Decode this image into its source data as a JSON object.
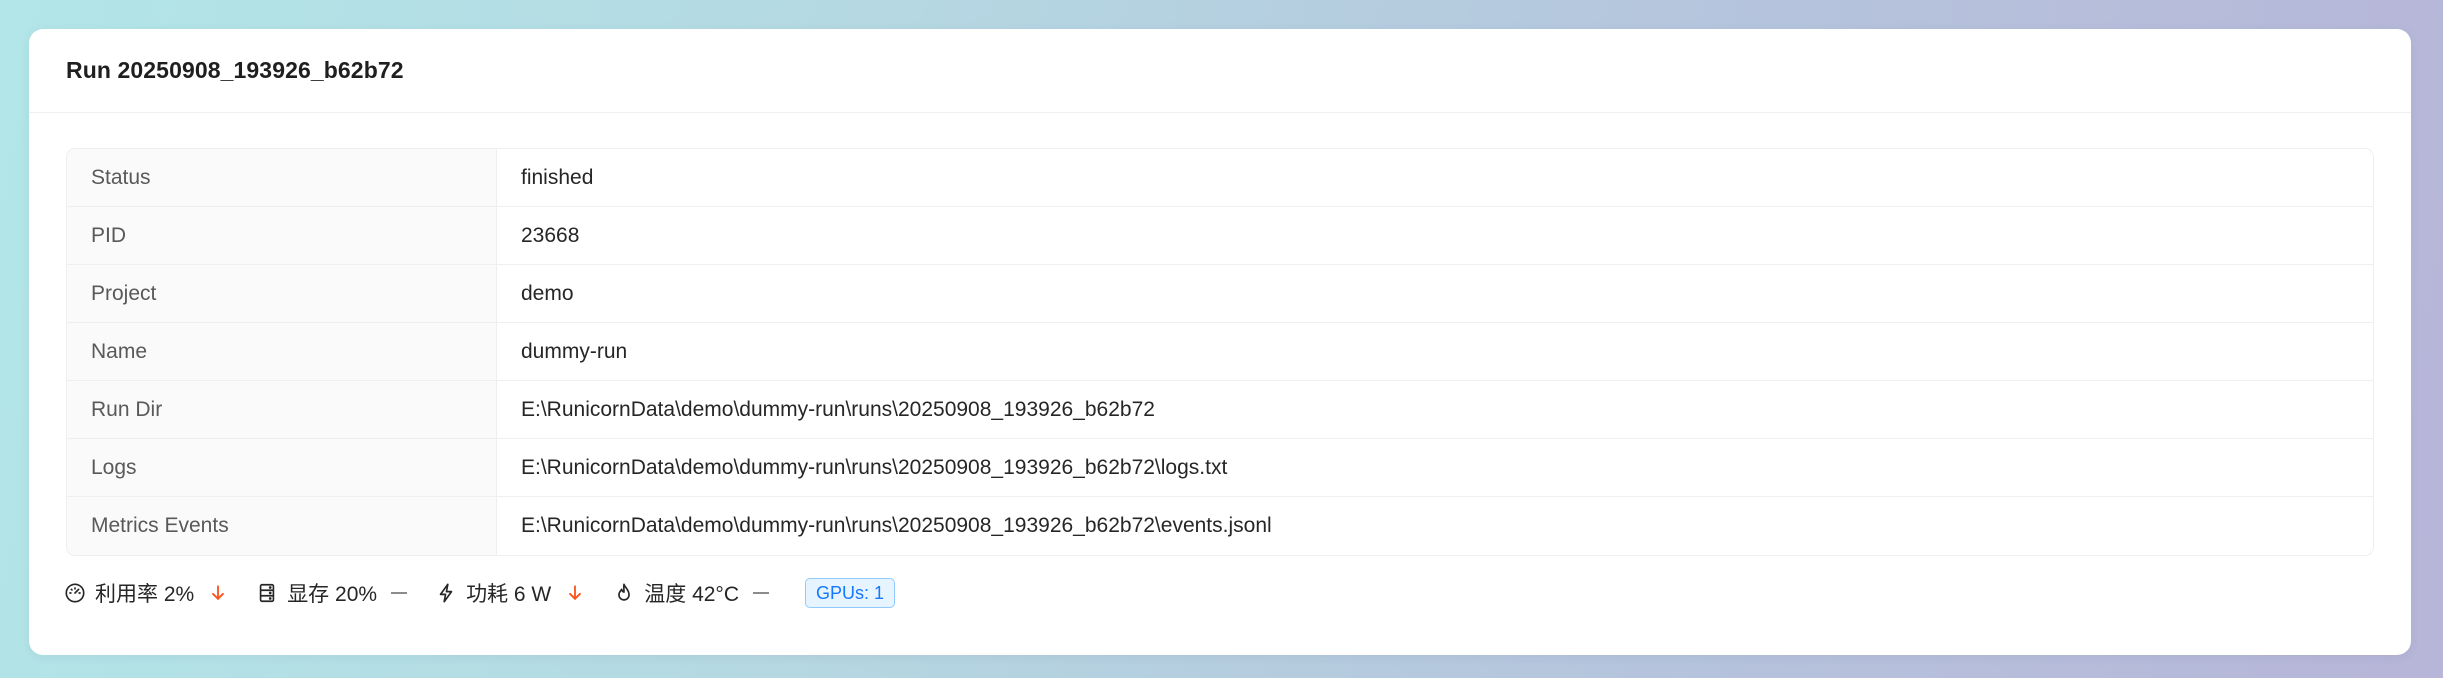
{
  "card": {
    "title": "Run 20250908_193926_b62b72"
  },
  "details": [
    {
      "label": "Status",
      "value": "finished"
    },
    {
      "label": "PID",
      "value": "23668"
    },
    {
      "label": "Project",
      "value": "demo"
    },
    {
      "label": "Name",
      "value": "dummy-run"
    },
    {
      "label": "Run Dir",
      "value": "E:\\RunicornData\\demo\\dummy-run\\runs\\20250908_193926_b62b72"
    },
    {
      "label": "Logs",
      "value": "E:\\RunicornData\\demo\\dummy-run\\runs\\20250908_193926_b62b72\\logs.txt"
    },
    {
      "label": "Metrics Events",
      "value": "E:\\RunicornData\\demo\\dummy-run\\runs\\20250908_193926_b62b72\\events.jsonl"
    }
  ],
  "gpu_metrics": [
    {
      "icon": "dashboard-icon",
      "text": "利用率 2%",
      "trend": "down"
    },
    {
      "icon": "memory-icon",
      "text": "显存 20%",
      "trend": "flat"
    },
    {
      "icon": "thunderbolt-icon",
      "text": "功耗 6 W",
      "trend": "down"
    },
    {
      "icon": "fire-icon",
      "text": "温度 42°C",
      "trend": "flat"
    }
  ],
  "gpu_tag": "GPUs: 1",
  "colors": {
    "trend_down": "#fa541c",
    "trend_flat": "#8c8c8c",
    "tag_blue": "#1677ff"
  }
}
